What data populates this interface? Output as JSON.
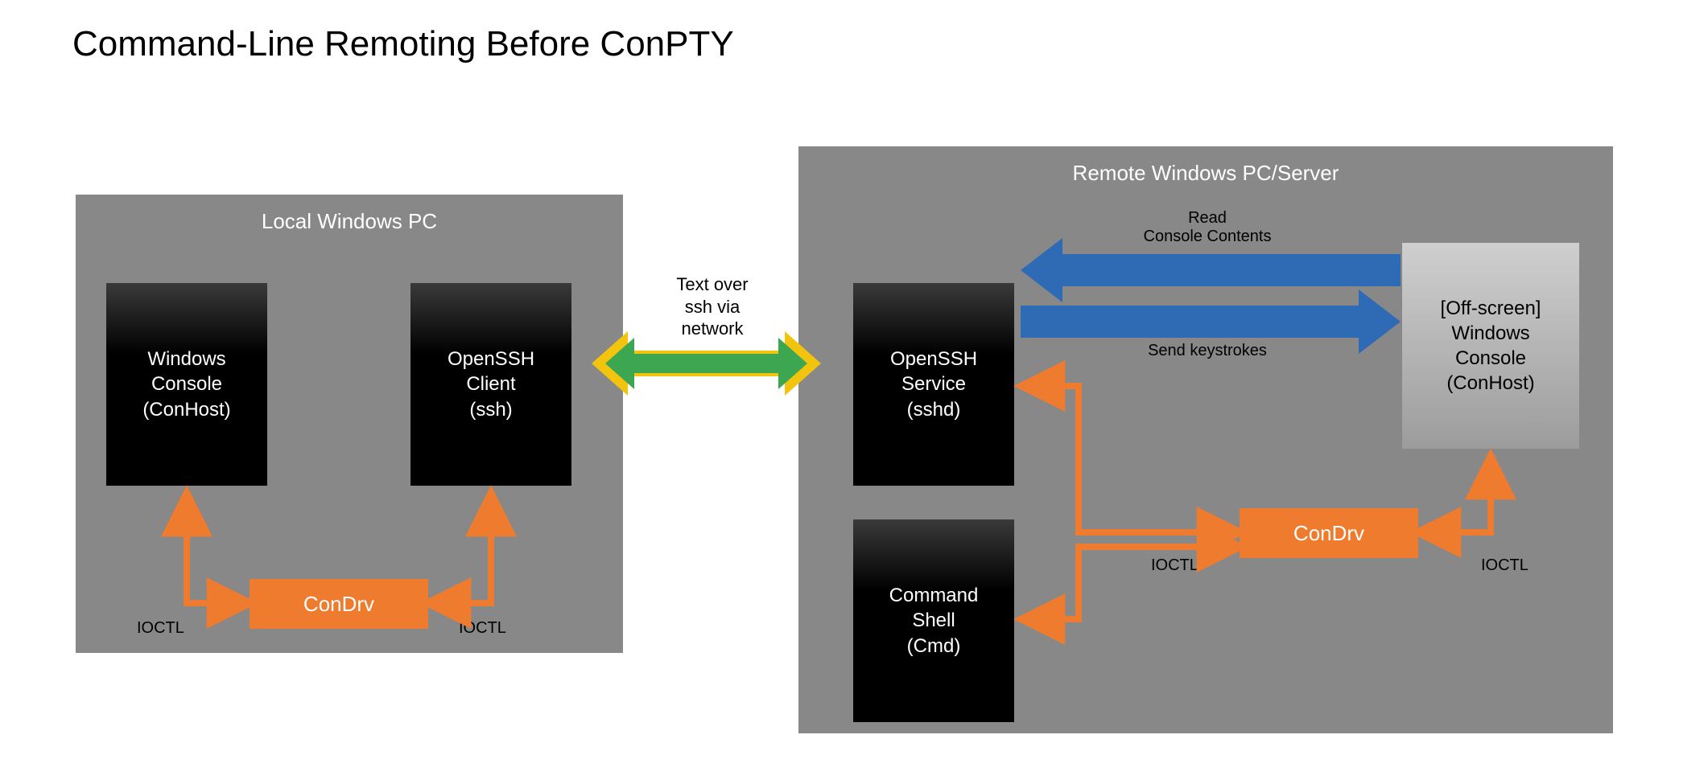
{
  "title": "Command-Line Remoting Before ConPTY",
  "local": {
    "panel_title": "Local Windows PC",
    "winconsole": "Windows\nConsole\n(ConHost)",
    "sshclient": "OpenSSH\nClient\n(ssh)",
    "condrv": "ConDrv",
    "ioctl_left": "IOCTL",
    "ioctl_right": "IOCTL"
  },
  "netlabel": "Text over\nssh via\nnetwork",
  "remote": {
    "panel_title": "Remote Windows PC/Server",
    "sshd": "OpenSSH\nService\n(sshd)",
    "cmd": "Command\nShell\n(Cmd)",
    "condrv": "ConDrv",
    "offscreen": "[Off-screen]\nWindows\nConsole\n(ConHost)",
    "ioctl_left": "IOCTL",
    "ioctl_right": "IOCTL",
    "read_label": "Read\nConsole Contents",
    "send_label": "Send keystrokes"
  },
  "colors": {
    "panel": "#888888",
    "orange": "#ee7b2e",
    "blue": "#2f6bb5",
    "yellow": "#f2c40d",
    "green": "#3da651"
  }
}
